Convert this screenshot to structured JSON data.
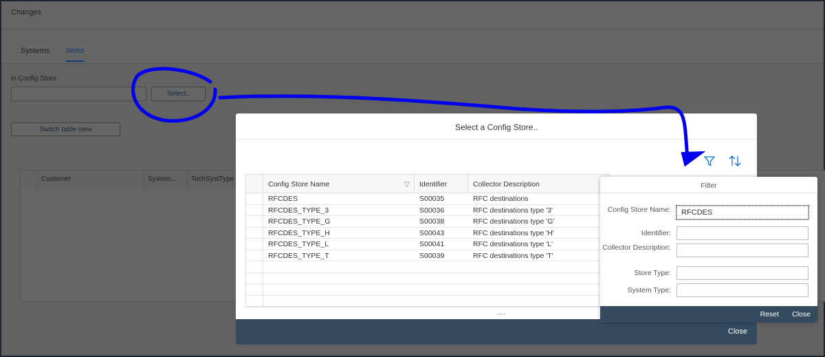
{
  "page": {
    "title": "Changes",
    "tabs": [
      {
        "label": "Systems"
      },
      {
        "label": "Items",
        "active": true
      }
    ],
    "config_store_label": "in Config Store",
    "config_store_value": "",
    "select_button": "Select..",
    "switch_button": "Switch table view",
    "table_columns": [
      "Customer",
      "System...",
      "TechSystType"
    ]
  },
  "dialog": {
    "title": "Select a Config Store..",
    "close_label": "Close",
    "icons": [
      "filter-icon",
      "sort-icon"
    ],
    "columns": [
      "Config Store Name",
      "Identifier",
      "Collector Description"
    ],
    "rows": [
      [
        "RFCDES",
        "S00035",
        "RFC destinations"
      ],
      [
        "RFCDES_TYPE_3",
        "S00036",
        "RFC destinations type '3'"
      ],
      [
        "RFCDES_TYPE_G",
        "S00038",
        "RFC destinations type 'G'"
      ],
      [
        "RFCDES_TYPE_H",
        "S00043",
        "RFC destinations type 'H'"
      ],
      [
        "RFCDES_TYPE_L",
        "S00041",
        "RFC destinations type 'L'"
      ],
      [
        "RFCDES_TYPE_T",
        "S00039",
        "RFC destinations type 'T'"
      ]
    ],
    "more": "...."
  },
  "filter": {
    "title": "Filter",
    "fields": [
      {
        "label": "Config Store Name:",
        "value": "RFCDES"
      },
      {
        "label": "Identifier:",
        "value": ""
      },
      {
        "label": "Collector Description:",
        "value": ""
      },
      {
        "label": "Store Type:",
        "value": ""
      },
      {
        "label": "System Type:",
        "value": ""
      }
    ],
    "reset_label": "Reset",
    "close_label": "Close"
  },
  "colors": {
    "accent": "#0a6ed1",
    "footer": "#354a5f",
    "annotation": "#0000ee"
  }
}
